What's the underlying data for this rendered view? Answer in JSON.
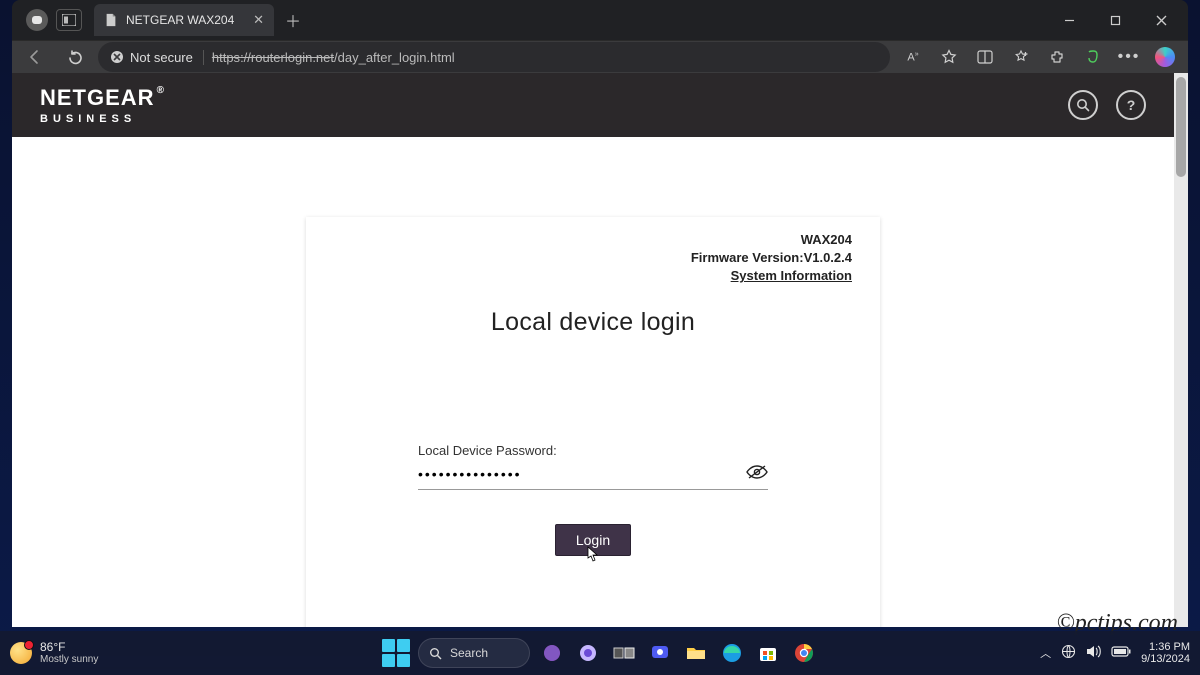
{
  "browser": {
    "tab_title": "NETGEAR WAX204",
    "security_label": "Not secure",
    "url_scheme": "https",
    "url_host": "://routerlogin.net",
    "url_path": "/day_after_login.html"
  },
  "header": {
    "brand": "NETGEAR",
    "brand_mark": "®",
    "subbrand": "BUSINESS"
  },
  "card": {
    "model": "WAX204",
    "firmware": "Firmware Version:V1.0.2.4",
    "sysinfo_link": "System Information",
    "title": "Local device login",
    "password_label": "Local Device Password:",
    "password_value": "•••••••••••••••",
    "login_button": "Login"
  },
  "watermark": "©pctips.com",
  "taskbar": {
    "temp": "86°F",
    "condition": "Mostly sunny",
    "search_placeholder": "Search",
    "time": "1:36 PM",
    "date": "9/13/2024"
  }
}
